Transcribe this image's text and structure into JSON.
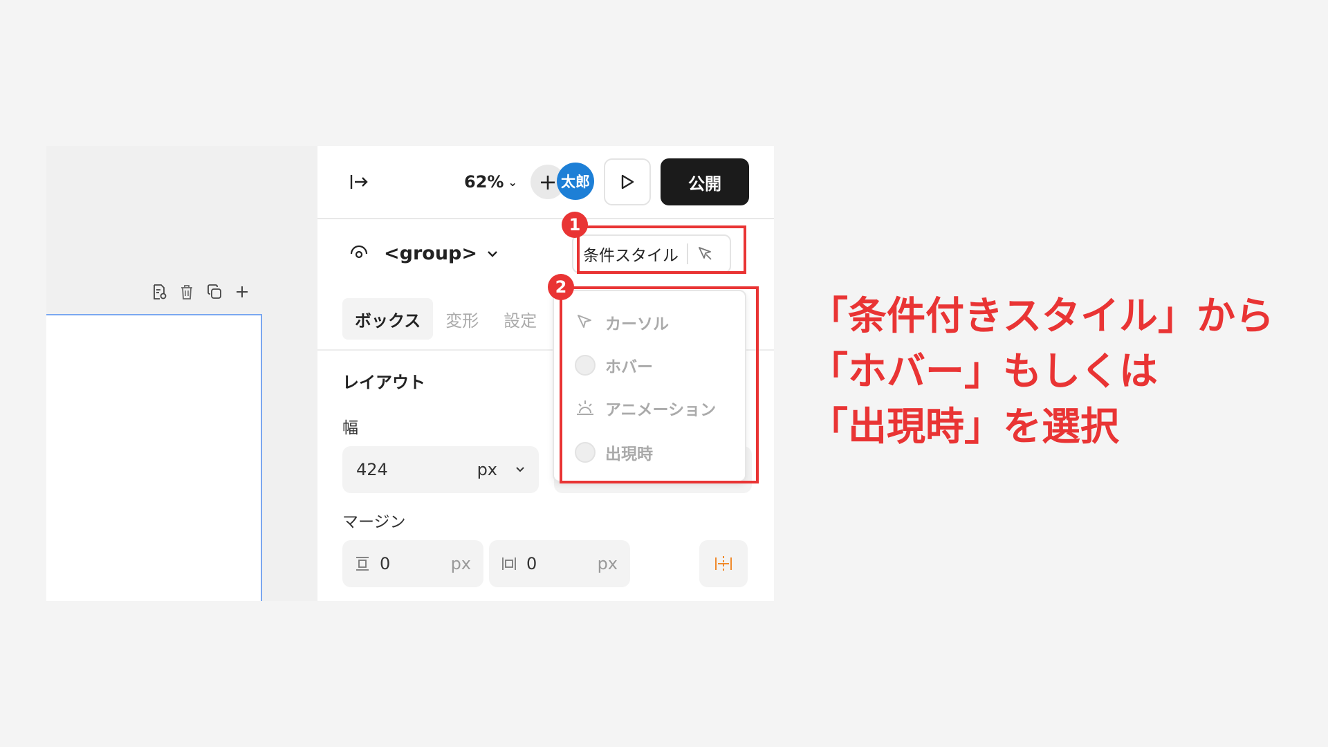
{
  "canvas": {
    "toolbar_icons": [
      "page-settings-icon",
      "trash-icon",
      "duplicate-icon",
      "plus-icon"
    ]
  },
  "header": {
    "zoom": "62%",
    "add_symbol": "+",
    "avatar": "太郎",
    "publish_label": "公開"
  },
  "element": {
    "name": "<group>",
    "conditional_style_label": "条件スタイル"
  },
  "tabs": [
    {
      "label": "ボックス",
      "active": true
    },
    {
      "label": "変形",
      "active": false
    },
    {
      "label": "設定",
      "active": false
    }
  ],
  "layout": {
    "section_title": "レイアウト",
    "width_label": "幅",
    "width_value": "424",
    "width_unit": "px",
    "margin_label": "マージン",
    "margin_vertical": {
      "value": "0",
      "unit": "px"
    },
    "margin_horizontal": {
      "value": "0",
      "unit": "px"
    }
  },
  "dropdown": {
    "items": [
      {
        "label": "カーソル",
        "icon": "cursor-icon"
      },
      {
        "label": "ホバー",
        "icon": "radio"
      },
      {
        "label": "アニメーション",
        "icon": "sunrise-icon"
      },
      {
        "label": "出現時",
        "icon": "radio"
      }
    ]
  },
  "annotations": {
    "badge1": "1",
    "badge2": "2",
    "highlight_color": "#e93434",
    "caption_lines": [
      "「条件付きスタイル」から",
      "「ホバー」もしくは",
      "「出現時」を選択"
    ]
  },
  "colors": {
    "accent_blue": "#1d7fd6",
    "publish_bg": "#1b1b1b",
    "annotation_red": "#e93434"
  }
}
